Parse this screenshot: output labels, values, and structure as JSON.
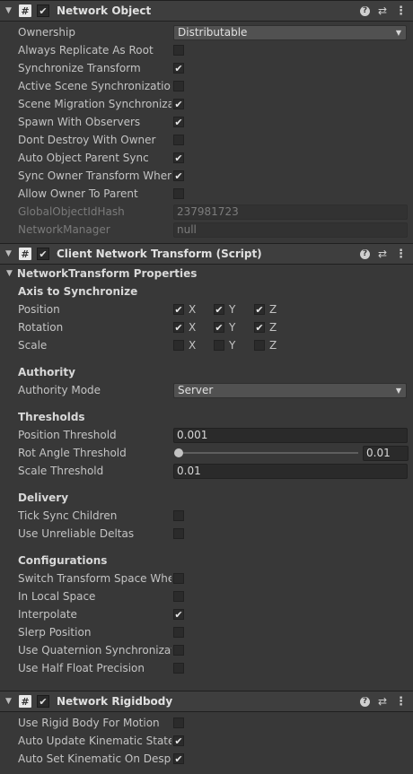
{
  "network_object": {
    "title": "Network Object",
    "enabled": true,
    "ownership_label": "Ownership",
    "ownership_value": "Distributable",
    "toggles": [
      {
        "label": "Always Replicate As Root",
        "checked": false
      },
      {
        "label": "Synchronize Transform",
        "checked": true
      },
      {
        "label": "Active Scene Synchronization",
        "checked": false
      },
      {
        "label": "Scene Migration Synchronization",
        "checked": true
      },
      {
        "label": "Spawn With Observers",
        "checked": true
      },
      {
        "label": "Dont Destroy With Owner",
        "checked": false
      },
      {
        "label": "Auto Object Parent Sync",
        "checked": true
      },
      {
        "label": "Sync Owner Transform When Parented",
        "checked": true
      },
      {
        "label": "Allow Owner To Parent",
        "checked": false
      }
    ],
    "hash_label": "GlobalObjectIdHash",
    "hash_value": "237981723",
    "manager_label": "NetworkManager",
    "manager_value": "null"
  },
  "client_network_transform": {
    "title": "Client Network Transform (Script)",
    "enabled": true,
    "properties_label": "NetworkTransform Properties",
    "axis_section": "Axis to Synchronize",
    "axes": [
      {
        "label": "Position",
        "x": true,
        "y": true,
        "z": true
      },
      {
        "label": "Rotation",
        "x": true,
        "y": true,
        "z": true
      },
      {
        "label": "Scale",
        "x": false,
        "y": false,
        "z": false
      }
    ],
    "axis_letters": {
      "x": "X",
      "y": "Y",
      "z": "Z"
    },
    "authority_section": "Authority",
    "authority_mode_label": "Authority Mode",
    "authority_mode_value": "Server",
    "thresholds_section": "Thresholds",
    "position_threshold_label": "Position Threshold",
    "position_threshold_value": "0.001",
    "rot_angle_label": "Rot Angle Threshold",
    "rot_angle_value": "0.01",
    "rot_angle_slider_fraction": 0.0,
    "scale_threshold_label": "Scale Threshold",
    "scale_threshold_value": "0.01",
    "delivery_section": "Delivery",
    "delivery": [
      {
        "label": "Tick Sync Children",
        "checked": false
      },
      {
        "label": "Use Unreliable Deltas",
        "checked": false
      }
    ],
    "config_section": "Configurations",
    "configurations": [
      {
        "label": "Switch Transform Space When Parented",
        "checked": false
      },
      {
        "label": "In Local Space",
        "checked": false
      },
      {
        "label": "Interpolate",
        "checked": true
      },
      {
        "label": "Slerp Position",
        "checked": false
      },
      {
        "label": "Use Quaternion Synchronization",
        "checked": false
      },
      {
        "label": "Use Half Float Precision",
        "checked": false
      }
    ]
  },
  "network_rigidbody": {
    "title": "Network Rigidbody",
    "enabled": true,
    "toggles": [
      {
        "label": "Use Rigid Body For Motion",
        "checked": false
      },
      {
        "label": "Auto Update Kinematic State",
        "checked": true
      },
      {
        "label": "Auto Set Kinematic On Despawn",
        "checked": true
      }
    ]
  },
  "icons": {
    "fold": "▼",
    "script": "#",
    "check": "✔",
    "help": "?",
    "preset": "⇄",
    "menu": "⋮",
    "dropdown_arrow": "▼"
  }
}
